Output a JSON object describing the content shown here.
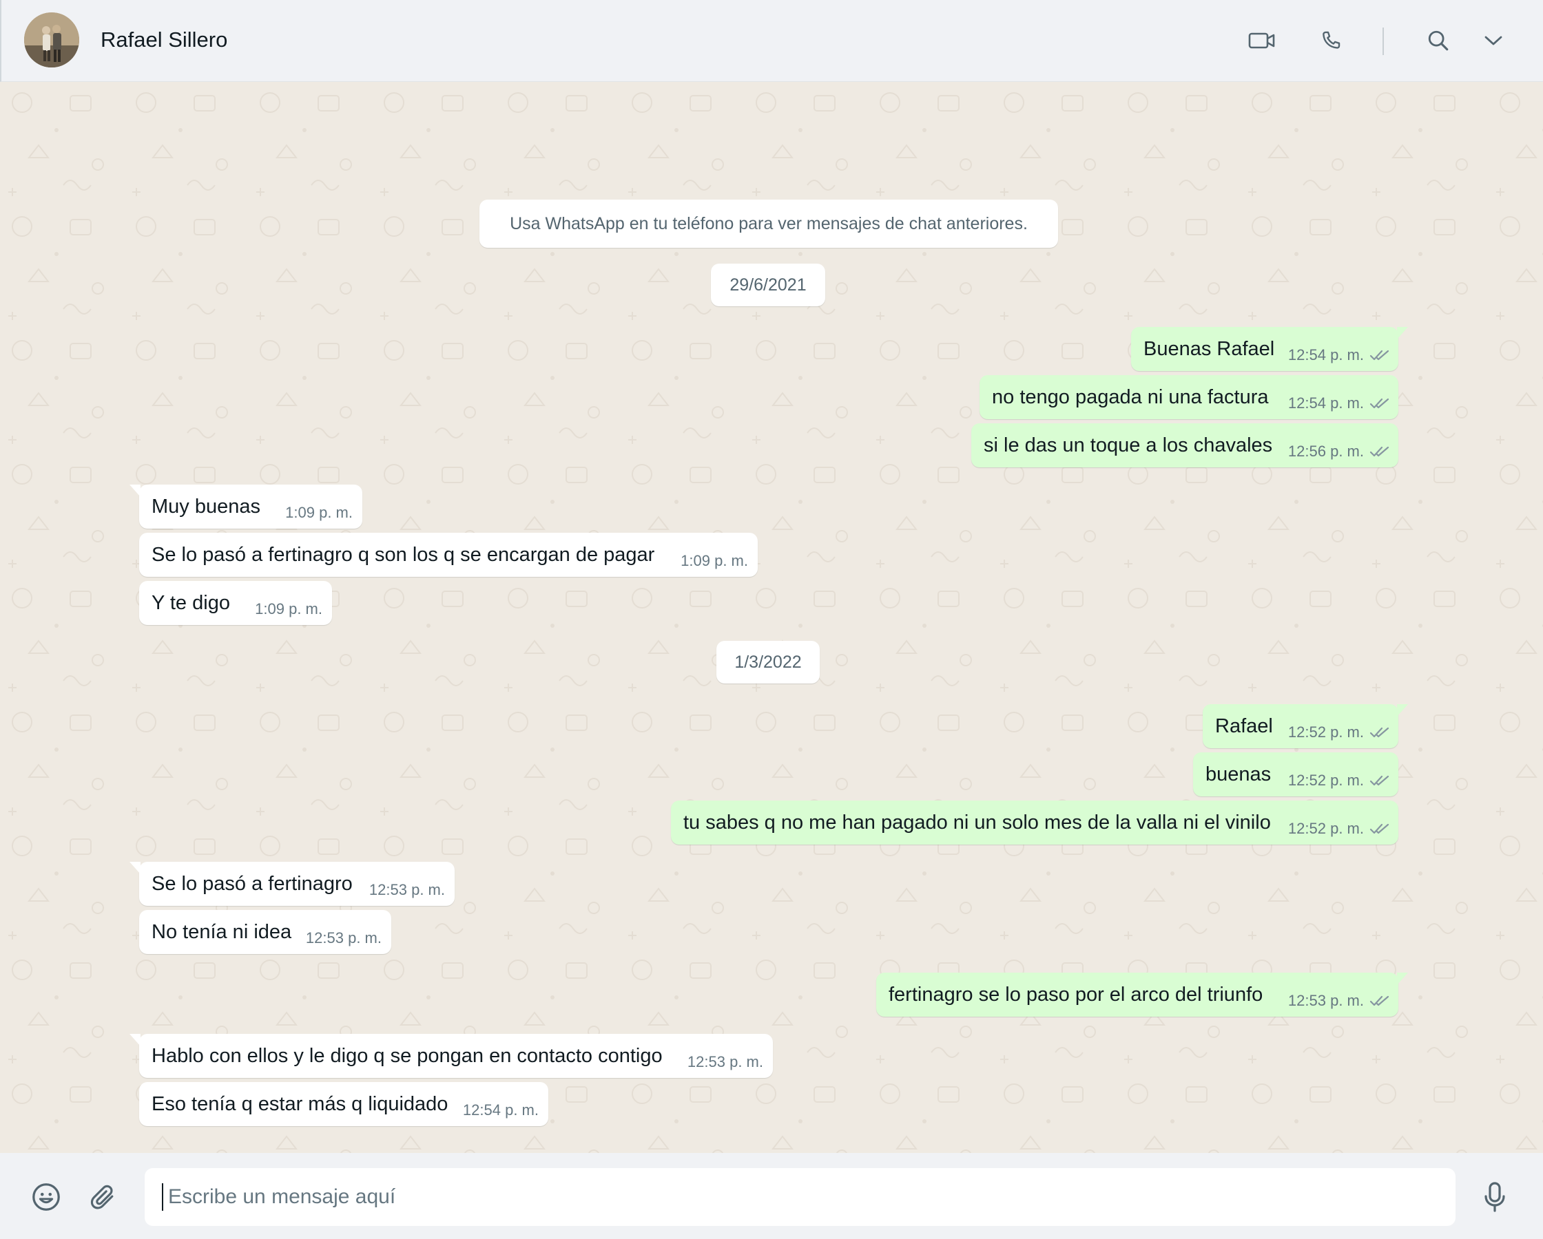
{
  "header": {
    "contact_name": "Rafael Sillero",
    "icons": [
      "video-call-icon",
      "voice-call-icon",
      "search-icon",
      "chevron-down-icon"
    ]
  },
  "chat": {
    "system_banner": "Usa WhatsApp en tu teléfono para ver mensajes de chat anteriores.",
    "dates": [
      "29/6/2021",
      "1/3/2022"
    ],
    "messages": [
      {
        "dir": "out",
        "text": "Buenas Rafael",
        "time": "12:54 p. m.",
        "status": "read"
      },
      {
        "dir": "out",
        "text": "no tengo pagada ni una factura",
        "time": "12:54 p. m.",
        "status": "read"
      },
      {
        "dir": "out",
        "text": "si le das un toque a los chavales",
        "time": "12:56 p. m.",
        "status": "read"
      },
      {
        "dir": "in",
        "text": "Muy buenas",
        "time": "1:09 p. m."
      },
      {
        "dir": "in",
        "text": "Se lo pasó a fertinagro q son los q se encargan de pagar",
        "time": "1:09 p. m."
      },
      {
        "dir": "in",
        "text": "Y te digo",
        "time": "1:09 p. m."
      },
      {
        "dir": "out",
        "text": "Rafael",
        "time": "12:52 p. m.",
        "status": "read"
      },
      {
        "dir": "out",
        "text": "buenas",
        "time": "12:52 p. m.",
        "status": "read"
      },
      {
        "dir": "out",
        "text": "tu sabes q no me han pagado ni un solo mes de la valla ni el vinilo",
        "time": "12:52 p. m.",
        "status": "read"
      },
      {
        "dir": "in",
        "text": "Se lo pasó a fertinagro",
        "time": "12:53 p. m."
      },
      {
        "dir": "in",
        "text": "No tenía ni idea",
        "time": "12:53 p. m."
      },
      {
        "dir": "out",
        "text": "fertinagro se lo paso por el arco del triunfo",
        "time": "12:53 p. m.",
        "status": "read"
      },
      {
        "dir": "in",
        "text": "Hablo con ellos y le digo q se pongan en contacto contigo",
        "time": "12:53 p. m."
      },
      {
        "dir": "in",
        "text": "Eso tenía q estar más q liquidado",
        "time": "12:54 p. m."
      }
    ]
  },
  "footer": {
    "input_placeholder": "Escribe un mensaje aquí",
    "icons": [
      "emoji-icon",
      "attach-icon",
      "microphone-icon"
    ]
  },
  "colors": {
    "header_bg": "#f0f2f5",
    "chat_bg": "#efeae2",
    "outgoing_bubble": "#d9fdd3",
    "incoming_bubble": "#ffffff",
    "read_ticks": "#8696a0"
  }
}
